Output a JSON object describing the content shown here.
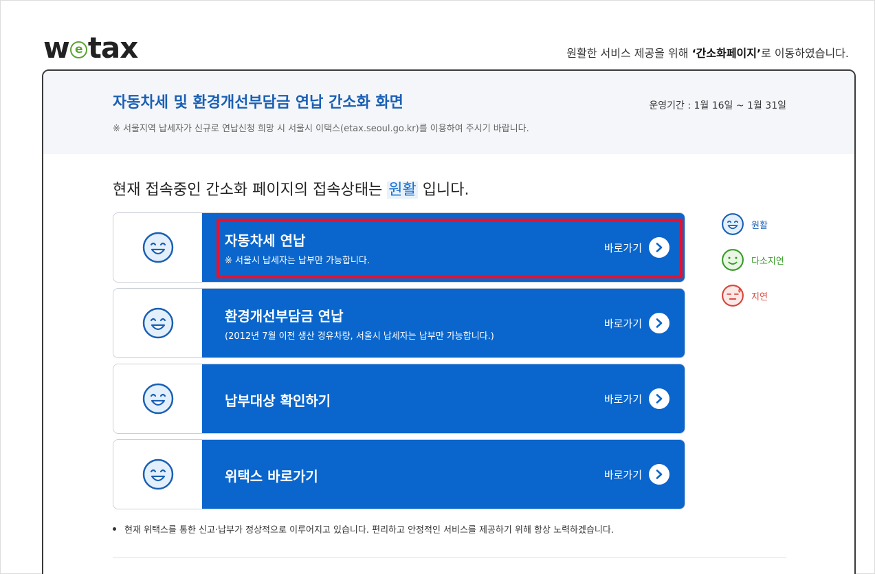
{
  "logo": {
    "part1": "w",
    "e": "e",
    "part2": "tax"
  },
  "top_notice": {
    "prefix": "원활한 서비스 제공을 위해 ",
    "highlight": "‘간소화페이지’",
    "suffix": "로 이동하였습니다."
  },
  "header": {
    "title": "자동차세 및 환경개선부담금 연납 간소화 화면",
    "period": "운영기간 : 1월 16일 ~ 1월 31일",
    "subtitle": "※ 서울지역 납세자가 신규로 연납신청 희망 시 서울시 이택스(etax.seoul.go.kr)를 이용하여 주시기 바랍니다."
  },
  "status": {
    "prefix": "현재 접속중인 간소화 페이지의 접속상태는 ",
    "value": "원활",
    "suffix": " 입니다."
  },
  "menu": [
    {
      "title": "자동차세 연납",
      "desc": "※ 서울시 납세자는 납부만 가능합니다.",
      "go_label": "바로가기"
    },
    {
      "title": "환경개선부담금 연납",
      "desc": "(2012년 7월 이전 생산 경유차량, 서울시 납세자는 납부만 가능합니다.)",
      "go_label": "바로가기"
    },
    {
      "title": "납부대상 확인하기",
      "desc": "",
      "go_label": "바로가기"
    },
    {
      "title": "위택스 바로가기",
      "desc": "",
      "go_label": "바로가기"
    }
  ],
  "legend": [
    {
      "label": "원활",
      "icon": "smile-face-icon",
      "color": "#1a5fb4"
    },
    {
      "label": "다소지연",
      "icon": "neutral-smile-face-icon",
      "color": "#3a9a2a"
    },
    {
      "label": "지연",
      "icon": "sweat-face-icon",
      "color": "#d9443a"
    }
  ],
  "footnote": "현재 위택스를 통한 신고·납부가 정상적으로 이루어지고 있습니다. 편리하고 안정적인 서비스를 제공하기 위해 항상 노력하겠습니다.",
  "colors": {
    "primary_blue": "#0a66cc",
    "title_blue": "#1a5fb4",
    "highlight_red": "#e8102c",
    "logo_green": "#5aa531"
  }
}
